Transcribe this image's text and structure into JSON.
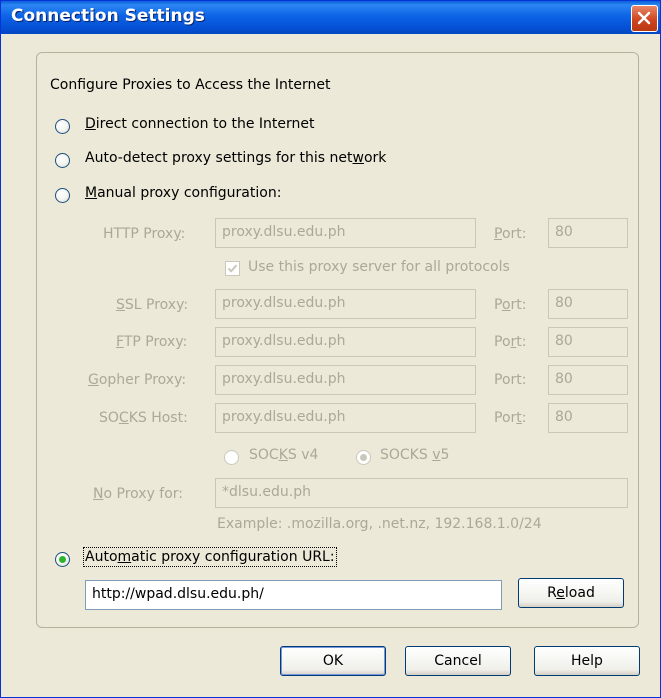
{
  "window": {
    "title": "Connection Settings"
  },
  "group": {
    "legend": "Configure Proxies to Access the Internet"
  },
  "options": {
    "direct": {
      "pre": "",
      "key": "D",
      "post": "irect connection to the Internet",
      "selected": false
    },
    "autodetect": {
      "pre": "Auto-detect proxy settings for this net",
      "key": "w",
      "post": "ork",
      "selected": false
    },
    "manual": {
      "pre": "",
      "key": "M",
      "post": "anual proxy configuration:",
      "selected": false
    },
    "auto_url": {
      "pre": "Auto",
      "key": "m",
      "post": "atic proxy configuration URL:",
      "selected": true
    }
  },
  "manual": {
    "http": {
      "label_pre": "HTTP Prox",
      "label_key": "y",
      "label_post": ":",
      "value": "proxy.dlsu.edu.ph",
      "port_pre": "",
      "port_key": "P",
      "port_post": "ort:",
      "port": "80"
    },
    "use_all": {
      "pre": "Use this proxy server for all protocols",
      "checked": true
    },
    "ssl": {
      "label_pre": "",
      "label_key": "S",
      "label_post": "SL Proxy:",
      "value": "proxy.dlsu.edu.ph",
      "port_pre": "P",
      "port_key": "o",
      "port_post": "rt:",
      "port": "80"
    },
    "ftp": {
      "label_pre": "",
      "label_key": "F",
      "label_post": "TP Proxy:",
      "value": "proxy.dlsu.edu.ph",
      "port_pre": "Po",
      "port_key": "r",
      "port_post": "t:",
      "port": "80"
    },
    "gopher": {
      "label_pre": "",
      "label_key": "G",
      "label_post": "opher Proxy:",
      "value": "proxy.dlsu.edu.ph",
      "port_pre": "Port:",
      "port_key": "",
      "port_post": "",
      "port": "80"
    },
    "socks": {
      "label_pre": "SO",
      "label_key": "C",
      "label_post": "KS Host:",
      "value": "proxy.dlsu.edu.ph",
      "port_pre": "Por",
      "port_key": "t",
      "port_post": ":",
      "port": "80"
    },
    "socks_v4": {
      "pre": "SOC",
      "key": "K",
      "post": "S v4",
      "selected": false
    },
    "socks_v5": {
      "pre": "SOCKS ",
      "key": "v",
      "post": "5",
      "selected": true
    },
    "no_proxy": {
      "label_pre": "",
      "label_key": "N",
      "label_post": "o Proxy for:",
      "value": "*dlsu.edu.ph"
    },
    "example": "Example: .mozilla.org, .net.nz, 192.168.1.0/24"
  },
  "auto_url": {
    "value": "http://wpad.dlsu.edu.ph/",
    "reload_pre": "R",
    "reload_key": "e",
    "reload_post": "load"
  },
  "buttons": {
    "ok": "OK",
    "cancel": "Cancel",
    "help": "Help"
  },
  "colors": {
    "title_bar": "#0a5fd8",
    "dialog_bg": "#ece9d8",
    "radio_dot": "#2db42d",
    "disabled_text": "#aca899"
  }
}
